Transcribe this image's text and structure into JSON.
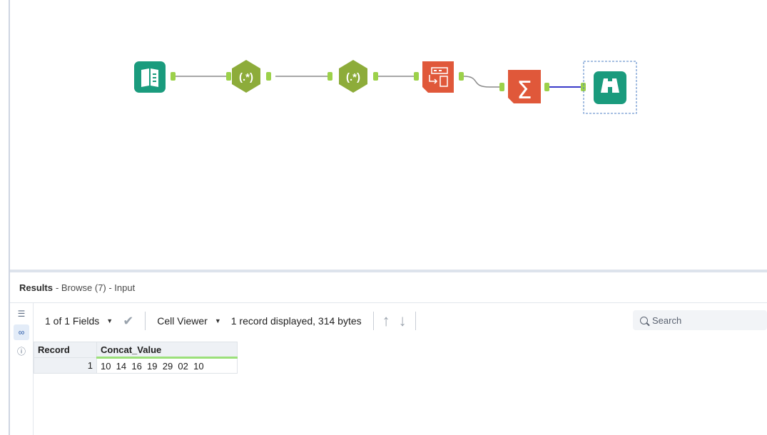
{
  "workflow": {
    "tools": [
      {
        "name": "input-data-tool",
        "color": "#1a9b7d",
        "icon": "book-icon"
      },
      {
        "name": "regex-tool-1",
        "color": "#8dac3a",
        "label": "(.*)"
      },
      {
        "name": "regex-tool-2",
        "color": "#8dac3a",
        "label": "(.*)"
      },
      {
        "name": "cross-tab-tool",
        "color": "#e0583a",
        "icon": "table-transpose-icon"
      },
      {
        "name": "summarize-tool",
        "color": "#e0583a",
        "label": "Σ"
      },
      {
        "name": "browse-tool",
        "color": "#1a9b7d",
        "icon": "binoculars-icon"
      }
    ],
    "connector_color": "#8a8a8a",
    "selected_connector_color": "#3a3ac8",
    "anchor_color": "#9cd14a"
  },
  "results": {
    "title": "Results",
    "subtitle": "- Browse (7) - Input",
    "toolbar": {
      "fields_label": "1 of 1 Fields",
      "cell_viewer_label": "Cell Viewer",
      "record_info": "1 record displayed, 314 bytes",
      "search_placeholder": "Search"
    },
    "table": {
      "headers": [
        "Record",
        "Concat_Value"
      ],
      "rows": [
        {
          "record": "1",
          "value": "10  14  16  19  29  02  10"
        }
      ]
    }
  }
}
